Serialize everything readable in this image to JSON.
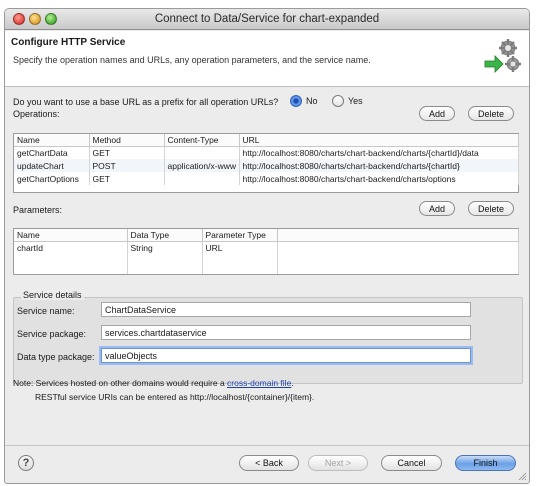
{
  "window": {
    "title": "Connect to Data/Service for chart-expanded"
  },
  "banner": {
    "title": "Configure HTTP Service",
    "subtitle": "Specify the operation names and URLs, any operation parameters, and the service name."
  },
  "base_url": {
    "question": "Do you want to use a base URL as a prefix for all operation URLs?",
    "options": [
      {
        "label": "No",
        "selected": true
      },
      {
        "label": "Yes",
        "selected": false
      }
    ]
  },
  "operations": {
    "label": "Operations:",
    "add_label": "Add",
    "delete_label": "Delete",
    "columns": [
      "Name",
      "Method",
      "Content-Type",
      "URL"
    ],
    "rows": [
      [
        "getChartData",
        "GET",
        "",
        "http://localhost:8080/charts/chart-backend/charts/{chartId}/data"
      ],
      [
        "updateChart",
        "POST",
        "application/x-www",
        "http://localhost:8080/charts/chart-backend/charts/{chartId}"
      ],
      [
        "getChartOptions",
        "GET",
        "",
        "http://localhost:8080/charts/chart-backend/charts/options"
      ]
    ]
  },
  "parameters": {
    "label": "Parameters:",
    "add_label": "Add",
    "delete_label": "Delete",
    "columns": [
      "Name",
      "Data Type",
      "Parameter Type"
    ],
    "rows": [
      [
        "chartId",
        "String",
        "URL"
      ]
    ]
  },
  "service_details": {
    "legend": "Service details",
    "name_label": "Service name:",
    "name_value": "ChartDataService",
    "package_label": "Service package:",
    "package_value": "services.chartdataservice",
    "datatype_label": "Data type package:",
    "datatype_value": "valueObjects"
  },
  "notes": {
    "line1_prefix": "Note: Services hosted on other domains would require a ",
    "line1_link": "cross-domain file",
    "line1_suffix": ".",
    "line2": "RESTful service URIs can be entered as http://localhost/{container}/{item}."
  },
  "footer": {
    "help_glyph": "?",
    "back_label": "< Back",
    "next_label": "Next >",
    "cancel_label": "Cancel",
    "finish_label": "Finish"
  },
  "colors": {
    "accent": "#6aa0e6",
    "selected_radio": "#1b4fb7",
    "link": "#1a3fb0"
  }
}
